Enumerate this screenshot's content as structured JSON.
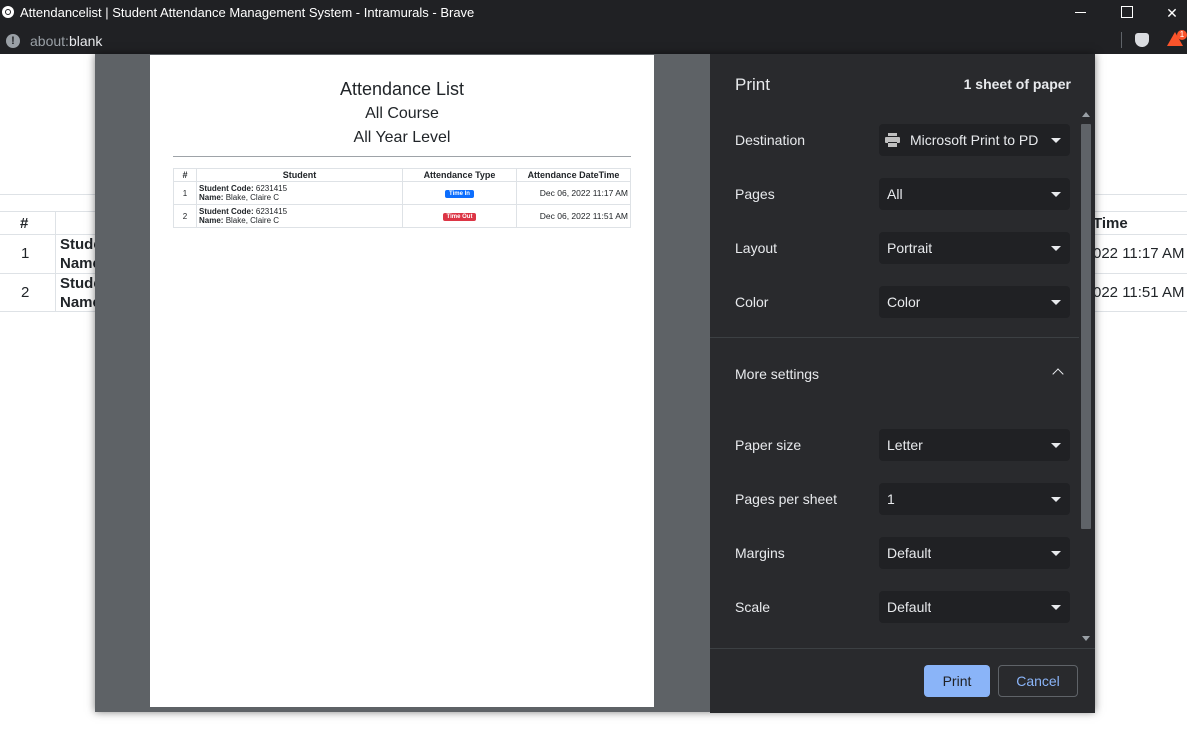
{
  "window": {
    "title": "Attendancelist | Student Attendance Management System - Intramurals - Brave",
    "min_symbol": "",
    "close_symbol": "✕"
  },
  "address": {
    "scheme": "about:",
    "path": "blank",
    "info_symbol": "!",
    "rewards_count": "1"
  },
  "background_page": {
    "hash_header": "#",
    "time_header_partial": "Time",
    "rows": [
      {
        "num": "1",
        "label1": "Stude",
        "label2": "Name",
        "time": "022 11:17 AM"
      },
      {
        "num": "2",
        "label1": "Stude",
        "label2": "Name",
        "time": "022 11:51 AM"
      }
    ]
  },
  "preview": {
    "title": "Attendance List",
    "course": "All Course",
    "year_level": "All Year Level",
    "table": {
      "headers": [
        "#",
        "Student",
        "Attendance Type",
        "Attendance DateTime"
      ],
      "rows": [
        {
          "num": "1",
          "code_label": "Student Code:",
          "code": "6231415",
          "name_label": "Name:",
          "name": "Blake, Claire C",
          "type": "Time In",
          "type_color": "#0d6efd",
          "datetime": "Dec 06, 2022 11:17 AM"
        },
        {
          "num": "2",
          "code_label": "Student Code:",
          "code": "6231415",
          "name_label": "Name:",
          "name": "Blake, Claire C",
          "type": "Time Out",
          "type_color": "#dc3545",
          "datetime": "Dec 06, 2022 11:51 AM"
        }
      ]
    }
  },
  "print_settings": {
    "title": "Print",
    "sheets": "1 sheet of paper",
    "destination": {
      "label": "Destination",
      "value": "Microsoft Print to PD"
    },
    "pages": {
      "label": "Pages",
      "value": "All"
    },
    "layout": {
      "label": "Layout",
      "value": "Portrait"
    },
    "color": {
      "label": "Color",
      "value": "Color"
    },
    "more_settings": "More settings",
    "paper_size": {
      "label": "Paper size",
      "value": "Letter"
    },
    "pages_per_sheet": {
      "label": "Pages per sheet",
      "value": "1"
    },
    "margins": {
      "label": "Margins",
      "value": "Default"
    },
    "scale": {
      "label": "Scale",
      "value": "Default"
    },
    "print_button": "Print",
    "cancel_button": "Cancel"
  },
  "colors": {
    "dialog_bg": "#292a2d",
    "select_bg": "#202124",
    "accent": "#8ab4f8"
  }
}
